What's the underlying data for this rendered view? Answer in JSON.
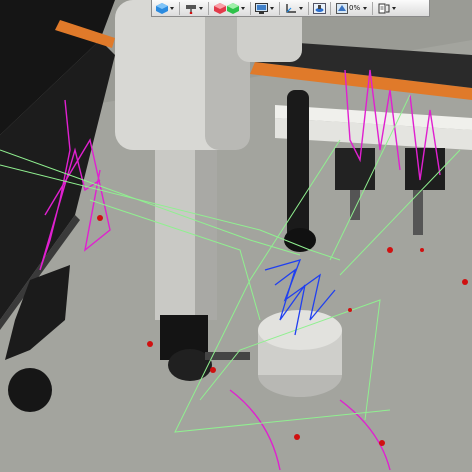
{
  "toolbar": {
    "buttons": [
      {
        "icon": "view-cube-icon",
        "has_dropdown": true
      },
      {
        "icon": "probe-head-icon",
        "has_dropdown": true
      },
      {
        "icon": "red-shading-icon",
        "has_dropdown": false
      },
      {
        "icon": "green-shading-icon",
        "has_dropdown": true
      },
      {
        "icon": "screen-capture-icon",
        "has_dropdown": true
      },
      {
        "icon": "coordinate-axes-icon",
        "has_dropdown": true
      },
      {
        "icon": "machine-view-icon",
        "has_dropdown": false
      },
      {
        "icon": "translucency-icon",
        "has_dropdown": true
      },
      {
        "icon": "display-options-icon",
        "has_dropdown": true
      }
    ],
    "translucency_value": "0%"
  },
  "scene": {
    "description_free": true,
    "colors": {
      "floor": "#9a9b95",
      "machine_body": "#d6d6d2",
      "frame_black": "#121212",
      "rail_orange": "#e07a2a",
      "toolpath_magenta": "#e020d0",
      "toolpath_green": "#90f090",
      "toolpath_blue": "#2040f0",
      "target_red": "#d01010"
    }
  }
}
